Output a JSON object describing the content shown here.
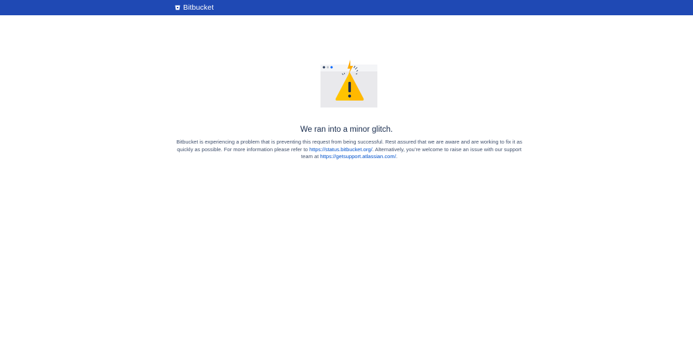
{
  "header": {
    "brand_name": "Bitbucket",
    "background_color": "#1f49b4",
    "logo_icon": "bitbucket-logo-icon"
  },
  "illustration": {
    "icon": "warning-triangle-icon",
    "window_dot_colors": [
      "#253858",
      "#0065ff",
      "#00b8d9"
    ],
    "warning_color": "#ffc400"
  },
  "error": {
    "title": "We ran into a minor glitch.",
    "text_part1": "Bitbucket is experiencing a problem that is preventing this request from being successful. Rest assured that we are aware and are working to fix it as quickly as possible. For more information please refer to ",
    "status_link": "https://status.bitbucket.org/",
    "text_part2": ". Alternatively, you’re welcome to raise an issue with our support team at ",
    "support_link": "https://getsupport.atlassian.com/",
    "text_part3": "."
  }
}
